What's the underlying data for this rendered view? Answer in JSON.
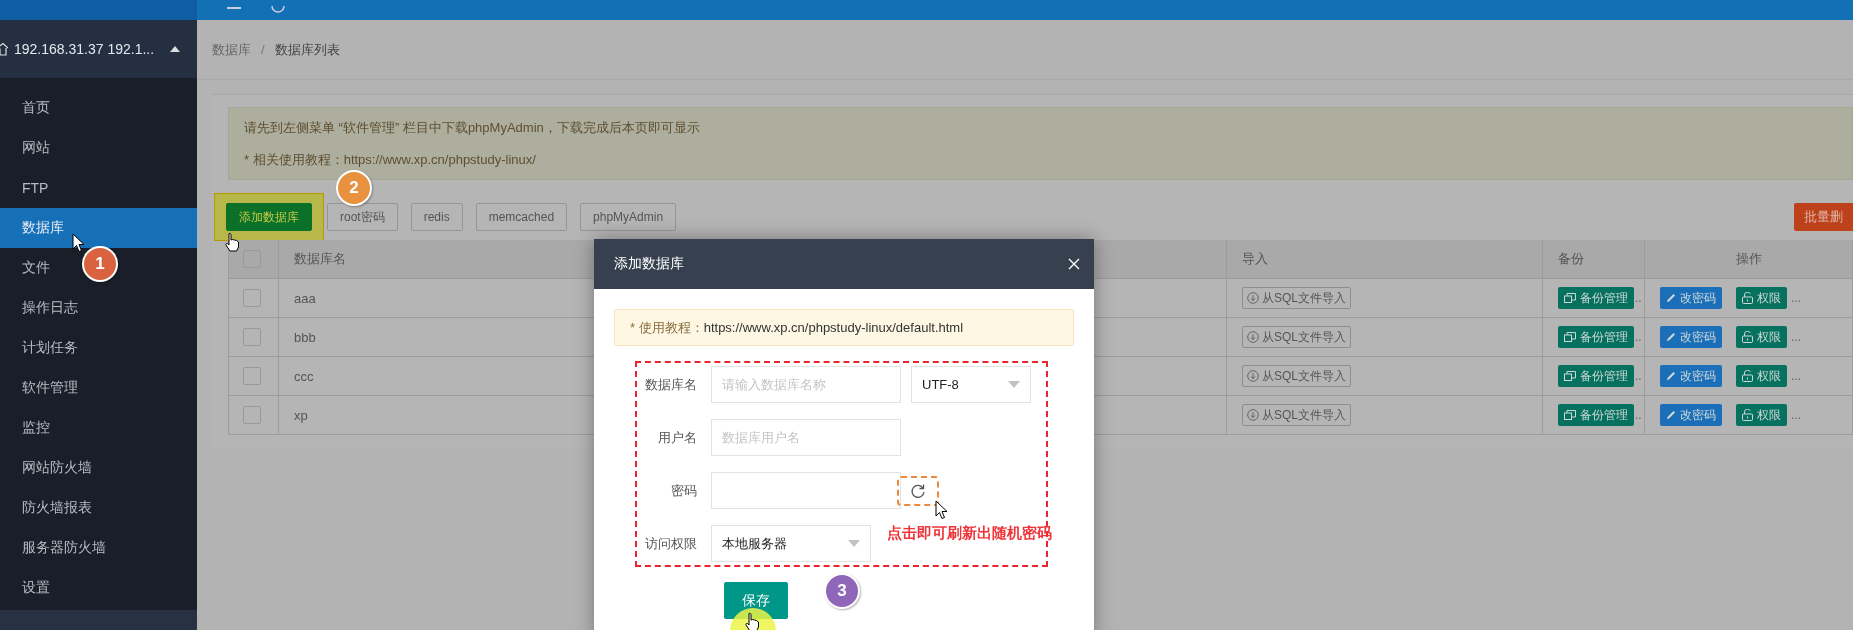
{
  "sidebar": {
    "server": "192.168.31.37 192.1...",
    "items": [
      {
        "label": "首页",
        "selected": false
      },
      {
        "label": "网站",
        "selected": false
      },
      {
        "label": "FTP",
        "selected": false
      },
      {
        "label": "数据库",
        "selected": true
      },
      {
        "label": "文件",
        "selected": false
      },
      {
        "label": "操作日志",
        "selected": false
      },
      {
        "label": "计划任务",
        "selected": false
      },
      {
        "label": "软件管理",
        "selected": false
      },
      {
        "label": "监控",
        "selected": false
      },
      {
        "label": "网站防火墙",
        "selected": false
      },
      {
        "label": "防火墙报表",
        "selected": false
      },
      {
        "label": "服务器防火墙",
        "selected": false
      },
      {
        "label": "设置",
        "selected": false
      }
    ]
  },
  "breadcrumb": [
    "数据库",
    "数据库列表"
  ],
  "breadcrumb_separator": "/",
  "notice": [
    "请先到左侧菜单 “软件管理” 栏目中下载phpMyAdmin，下载完成后本页即可显示",
    "* 相关使用教程：https://www.xp.cn/phpstudy-linux/"
  ],
  "toolbar": {
    "buttons": [
      {
        "label": "添加数据库",
        "kind": "primary"
      },
      {
        "label": "root密码",
        "kind": "plain"
      },
      {
        "label": "redis",
        "kind": "plain"
      },
      {
        "label": "memcached",
        "kind": "plain"
      },
      {
        "label": "phpMyAdmin",
        "kind": "plain"
      }
    ],
    "bulk_delete": "批量删"
  },
  "table": {
    "columns": [
      "数据库名",
      "导入",
      "备份",
      "操作"
    ],
    "header_checked": false,
    "rows": [
      {
        "name": "aaa",
        "checked": false,
        "import": "从SQL文件导入",
        "backup": "备份管理",
        "backup_more": "..",
        "change_password": "改密码",
        "permissions": "权限",
        "more": "..."
      },
      {
        "name": "bbb",
        "checked": false,
        "import": "从SQL文件导入",
        "backup": "备份管理",
        "backup_more": "..",
        "change_password": "改密码",
        "permissions": "权限",
        "more": "..."
      },
      {
        "name": "ccc",
        "checked": false,
        "import": "从SQL文件导入",
        "backup": "备份管理",
        "backup_more": "..",
        "change_password": "改密码",
        "permissions": "权限",
        "more": "..."
      },
      {
        "name": "xp",
        "checked": false,
        "import": "从SQL文件导入",
        "backup": "备份管理",
        "backup_more": "..",
        "change_password": "改密码",
        "permissions": "权限",
        "more": "..."
      }
    ]
  },
  "dialog": {
    "title": "添加数据库",
    "notice_label": "* 使用教程：",
    "notice_url": "https://www.xp.cn/phpstudy-linux/default.html",
    "fields": [
      {
        "label": "数据库名",
        "kind": "text_with_select",
        "placeholder": "请输入数据库名称",
        "select": "UTF-8"
      },
      {
        "label": "用户名",
        "kind": "text",
        "placeholder": "数据库用户名"
      },
      {
        "label": "密码",
        "kind": "password"
      },
      {
        "label": "访问权限",
        "kind": "select",
        "value": "本地服务器"
      }
    ],
    "save": "保存"
  },
  "annotations": {
    "steps": [
      {
        "number": "1",
        "color": "#d9623f"
      },
      {
        "number": "2",
        "color": "#e8913f"
      },
      {
        "number": "3",
        "color": "#9066b8"
      }
    ],
    "hint": "点击即可刷新出随机密码"
  }
}
